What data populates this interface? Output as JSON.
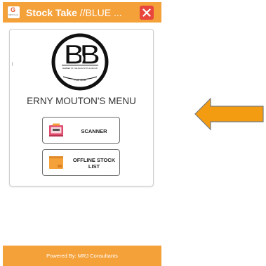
{
  "app": {
    "icon_letter": "G",
    "icon_subtext": "MRJ Cons",
    "title_bold": "Stock Take",
    "title_normal": " //BLUE ...",
    "close_icon": "close-icon"
  },
  "menu": {
    "logo_letters": "BB",
    "logo_top_text": "MEMBER OF THE BLUE BOTTLE GROUP",
    "logo_bottom_text": "PLATINUM",
    "title": "ERNY MOUTON'S MENU",
    "buttons": [
      {
        "label": "SCANNER",
        "icon": "scanner-icon"
      },
      {
        "label": "OFFLINE STOCK LIST",
        "icon": "offline-list-icon"
      }
    ]
  },
  "footer": {
    "text": "Powered By: MRJ Consultants"
  },
  "annotation": {
    "arrow": "left-arrow",
    "color": "#f39c12"
  },
  "colors": {
    "accent": "#f5a13a",
    "close": "#e8453c"
  }
}
